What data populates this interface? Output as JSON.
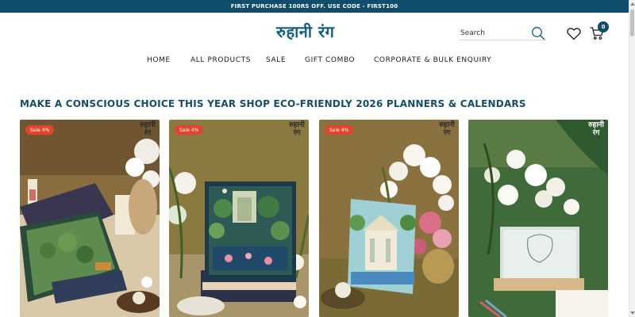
{
  "announcement": "FIRST PURCHASE 100RS OFF. USE CODE - FIRST100",
  "brand": {
    "logo_text": "रुहानी रंग",
    "accent": "#12617f",
    "bar_color": "#0f4d6b",
    "sale_color": "#e2452f"
  },
  "header": {
    "search_placeholder": "Search",
    "cart_count": "0",
    "icons": [
      "search-icon",
      "heart-icon",
      "cart-icon"
    ]
  },
  "nav": {
    "items": [
      "HOME",
      "ALL PRODUCTS",
      "SALE",
      "GIFT COMBO",
      "CORPORATE & BULK ENQUIRY"
    ]
  },
  "headline": "MAKE A CONSCIOUS CHOICE THIS YEAR SHOP ECO-FRIENDLY 2026 PLANNERS & CALENDARS",
  "products": [
    {
      "badge": "Sale 4%",
      "logo_line1": "रुहानी",
      "logo_line2": "रंग"
    },
    {
      "badge": "Sale 4%",
      "logo_line1": "रुहानी",
      "logo_line2": "रंग"
    },
    {
      "badge": "Sale 4%",
      "logo_line1": "रुहानी",
      "logo_line2": "रंग"
    },
    {
      "badge": "",
      "logo_line1": "रुहानी",
      "logo_line2": "रंग"
    }
  ]
}
